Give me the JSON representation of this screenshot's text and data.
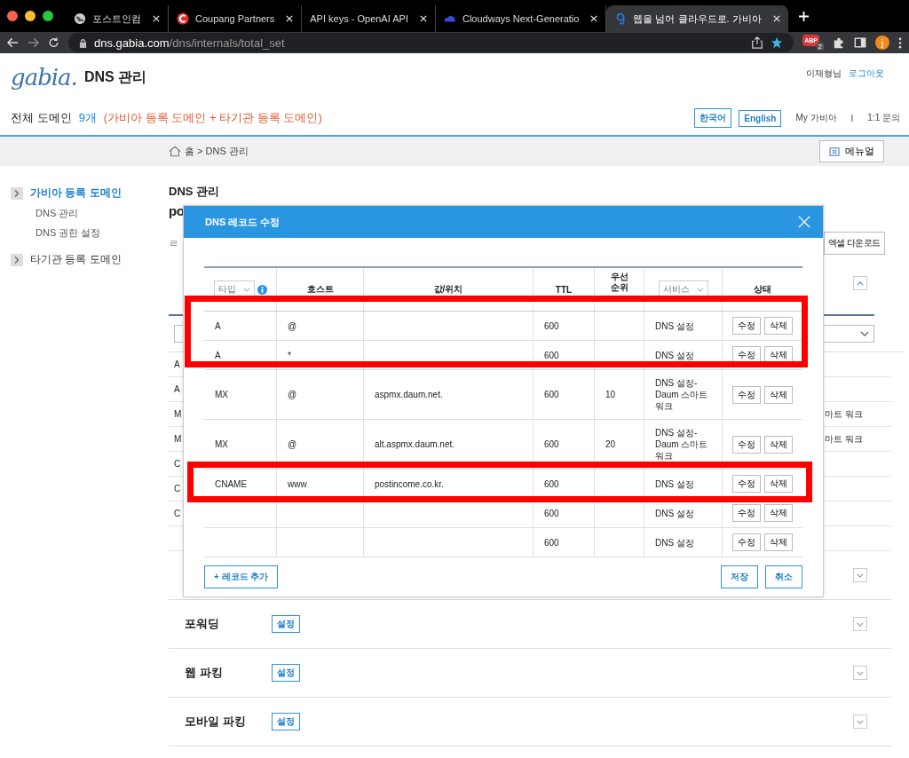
{
  "browser": {
    "tabs": [
      {
        "title": "포스트인컴",
        "selected": false
      },
      {
        "title": "Coupang Partners",
        "selected": false
      },
      {
        "title": "API keys - OpenAI API",
        "selected": false
      },
      {
        "title": "Cloudways Next-Generatio",
        "selected": false
      },
      {
        "title": "웹을 넘어 클라우드로. 가비아",
        "selected": true
      }
    ],
    "address": {
      "domain": "dns.gabia.com",
      "path": "/dns/internals/total_set"
    },
    "extension_badge": {
      "label": "ABP",
      "count": "2"
    },
    "profile": "j"
  },
  "header": {
    "logo": "gabia.",
    "title": "DNS 관리",
    "user": "이재형님",
    "logout": "로그아웃",
    "domains_label": "전체 도메인",
    "count": "9개",
    "note": "(가비아 등록 도메인 + 타기관 등록 도메인)",
    "languages": [
      "한국어",
      "English"
    ],
    "links": [
      "My 가비아",
      "I",
      "1:1 문의"
    ]
  },
  "breadcrumb": {
    "path": "홈 > DNS 관리",
    "manual_button": "메뉴얼"
  },
  "sidebar": {
    "groups": [
      {
        "label": "가비아 등록 도메인",
        "selected": true,
        "children": [
          {
            "label": "DNS 관리"
          },
          {
            "label": "DNS 권한 설정"
          }
        ]
      },
      {
        "label": "타기관 등록 도메인",
        "selected": false
      }
    ]
  },
  "main": {
    "title": "DNS 관리",
    "heading_fragment": "po",
    "bullet_fragment": "ㄹ",
    "excel_button": "엑셀 다운로드",
    "background_rows": [
      {
        "column_1": "A"
      },
      {
        "column_1": "A"
      },
      {
        "column_1": "M",
        "column_last": "마트 워크"
      },
      {
        "column_1": "M",
        "column_last": "마트 워크"
      },
      {
        "column_1": "C"
      },
      {
        "column_1": "C"
      },
      {
        "column_1": "C"
      }
    ],
    "sections": [
      {
        "title": "포워딩",
        "button": "설정"
      },
      {
        "title": "웹 파킹",
        "button": "설정"
      },
      {
        "title": "모바일 파킹",
        "button": "설정"
      }
    ]
  },
  "modal": {
    "title": "DNS 레코드 수정",
    "columns": [
      {
        "label": "타입",
        "kind": "select",
        "info": true
      },
      {
        "label": "호스트",
        "kind": "text"
      },
      {
        "label": "값/위치",
        "kind": "text"
      },
      {
        "label": "TTL",
        "kind": "text"
      },
      {
        "label": "우선 순위",
        "kind": "text"
      },
      {
        "label": "서비스",
        "kind": "select"
      },
      {
        "label": "상태",
        "kind": "text"
      }
    ],
    "rows": [
      {
        "type": "A",
        "host": "@",
        "ttl": "600",
        "service": "DNS 설정",
        "actions": [
          "수정",
          "삭제"
        ]
      },
      {
        "type": "A",
        "host": "*",
        "ttl": "600",
        "service": "DNS 설정",
        "actions": [
          "수정",
          "삭제"
        ]
      },
      {
        "type": "MX",
        "host": "@",
        "value": "aspmx.daum.net.",
        "ttl": "600",
        "priority": "10",
        "service": "DNS 설정-Daum 스마트 워크",
        "actions": [
          "수정",
          "삭제"
        ]
      },
      {
        "type": "MX",
        "host": "@",
        "value": "alt.aspmx.daum.net.",
        "ttl": "600",
        "priority": "20",
        "service": "DNS 설정-Daum 스마트 워크",
        "actions": [
          "수정",
          "삭제"
        ]
      },
      {
        "type": "CNAME",
        "host": "www",
        "value": "postincome.co.kr.",
        "ttl": "600",
        "service": "DNS 설정",
        "actions": [
          "수정",
          "삭제"
        ]
      },
      {
        "ttl": "600",
        "service": "DNS 설정",
        "actions": [
          "수정",
          "삭제"
        ]
      },
      {
        "ttl": "600",
        "service": "DNS 설정",
        "actions": [
          "수정",
          "삭제"
        ]
      }
    ],
    "add_button": "+ 레코드 추가",
    "save_button": "저장",
    "cancel_button": "취소"
  }
}
